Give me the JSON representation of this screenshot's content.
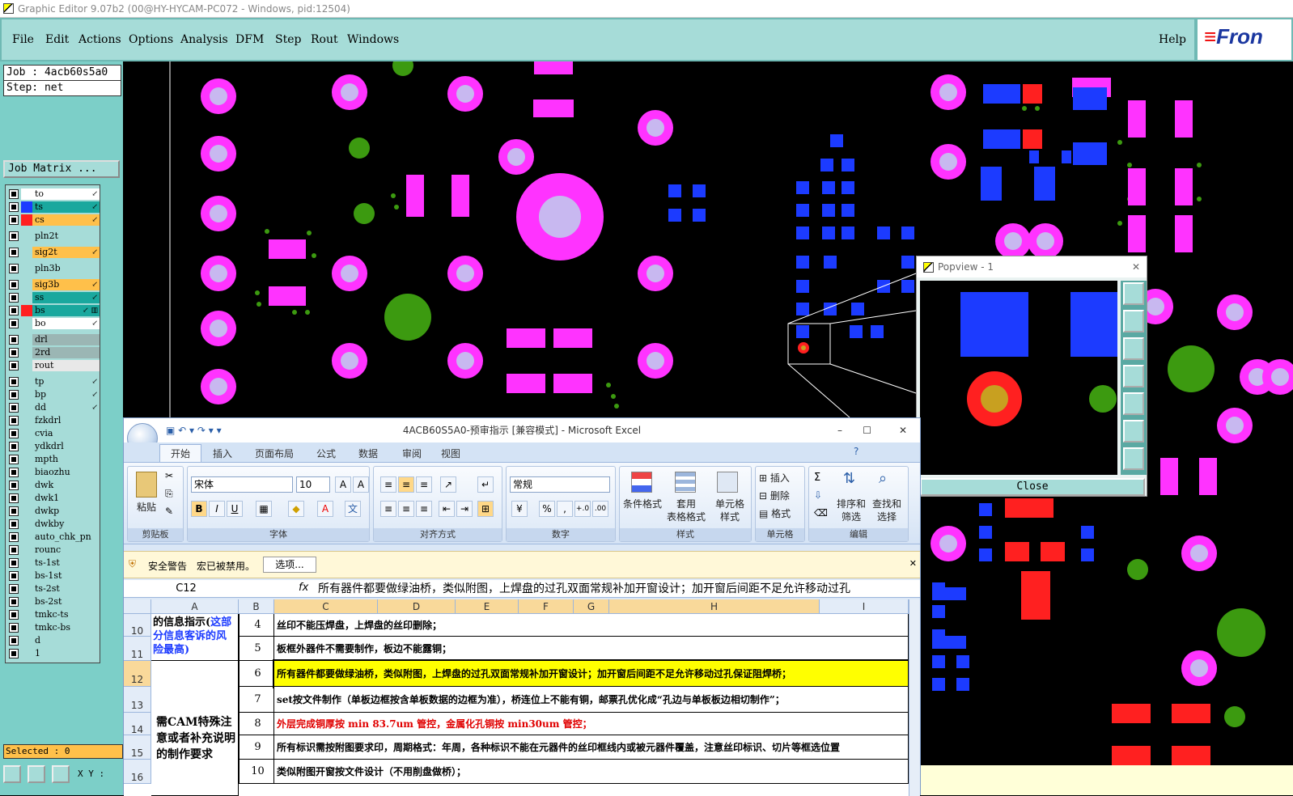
{
  "window": {
    "title": "Graphic Editor 9.07b2 (00@HY-HYCAM-PC072 - Windows, pid:12504)"
  },
  "menu": {
    "items": [
      "File",
      "Edit",
      "Actions",
      "Options",
      "Analysis",
      "DFM",
      "Step",
      "Rout",
      "Windows"
    ],
    "help": "Help",
    "brand": "Fron"
  },
  "job": {
    "job_line": "Job : 4acb60s5a0",
    "step_line": "Step: net",
    "matrix_button": "Job Matrix ..."
  },
  "layers": [
    {
      "name": "to",
      "color": "#ffffff",
      "fill": "#ffffff",
      "flag": "↙"
    },
    {
      "name": "ts",
      "color": "#1c3bff",
      "fill": "#1aa89e",
      "flag": "↙"
    },
    {
      "name": "cs",
      "color": "#ff2020",
      "fill": "#ffc04a",
      "flag": "↙"
    },
    {
      "name": "pln2t",
      "color": "#a6dcd8",
      "fill": "#a6dcd8",
      "flag": ""
    },
    {
      "name": "sig2t",
      "color": "#a6dcd8",
      "fill": "#ffc04a",
      "flag": "↙"
    },
    {
      "name": "pln3b",
      "color": "#a6dcd8",
      "fill": "#a6dcd8",
      "flag": ""
    },
    {
      "name": "sig3b",
      "color": "#a6dcd8",
      "fill": "#ffc04a",
      "flag": "↙"
    },
    {
      "name": "ss",
      "color": "#a6dcd8",
      "fill": "#1aa89e",
      "flag": "↙"
    },
    {
      "name": "bs",
      "color": "#ff2020",
      "fill": "#1aa89e",
      "flag": "↙ ▥"
    },
    {
      "name": "bo",
      "color": "#a6dcd8",
      "fill": "#ffffff",
      "flag": "↙"
    },
    {
      "name": "drl",
      "color": "#a6dcd8",
      "fill": "#9bb6b4",
      "flag": ""
    },
    {
      "name": "2rd",
      "color": "#a6dcd8",
      "fill": "#9bb6b4",
      "flag": ""
    },
    {
      "name": "rout",
      "color": "#a6dcd8",
      "fill": "#e8e8e8",
      "flag": ""
    },
    {
      "name": "tp",
      "color": "#a6dcd8",
      "fill": "#a6dcd8",
      "flag": "↙"
    },
    {
      "name": "bp",
      "color": "#a6dcd8",
      "fill": "#a6dcd8",
      "flag": "↙"
    },
    {
      "name": "dd",
      "color": "#a6dcd8",
      "fill": "#a6dcd8",
      "flag": "↙"
    },
    {
      "name": "fzkdrl",
      "color": "#a6dcd8",
      "fill": "#a6dcd8",
      "flag": ""
    },
    {
      "name": "cvia",
      "color": "#a6dcd8",
      "fill": "#a6dcd8",
      "flag": ""
    },
    {
      "name": "ydkdrl",
      "color": "#a6dcd8",
      "fill": "#a6dcd8",
      "flag": ""
    },
    {
      "name": "mpth",
      "color": "#a6dcd8",
      "fill": "#a6dcd8",
      "flag": ""
    },
    {
      "name": "biaozhu",
      "color": "#a6dcd8",
      "fill": "#a6dcd8",
      "flag": ""
    },
    {
      "name": "dwk",
      "color": "#a6dcd8",
      "fill": "#a6dcd8",
      "flag": ""
    },
    {
      "name": "dwk1",
      "color": "#a6dcd8",
      "fill": "#a6dcd8",
      "flag": ""
    },
    {
      "name": "dwkp",
      "color": "#a6dcd8",
      "fill": "#a6dcd8",
      "flag": ""
    },
    {
      "name": "dwkby",
      "color": "#a6dcd8",
      "fill": "#a6dcd8",
      "flag": ""
    },
    {
      "name": "auto_chk_pn",
      "color": "#a6dcd8",
      "fill": "#a6dcd8",
      "flag": ""
    },
    {
      "name": "rounc",
      "color": "#a6dcd8",
      "fill": "#a6dcd8",
      "flag": ""
    },
    {
      "name": "ts-1st",
      "color": "#a6dcd8",
      "fill": "#a6dcd8",
      "flag": ""
    },
    {
      "name": "bs-1st",
      "color": "#a6dcd8",
      "fill": "#a6dcd8",
      "flag": ""
    },
    {
      "name": "ts-2st",
      "color": "#a6dcd8",
      "fill": "#a6dcd8",
      "flag": ""
    },
    {
      "name": "bs-2st",
      "color": "#a6dcd8",
      "fill": "#a6dcd8",
      "flag": ""
    },
    {
      "name": "tmkc-ts",
      "color": "#a6dcd8",
      "fill": "#a6dcd8",
      "flag": ""
    },
    {
      "name": "tmkc-bs",
      "color": "#a6dcd8",
      "fill": "#a6dcd8",
      "flag": ""
    },
    {
      "name": "d",
      "color": "#a6dcd8",
      "fill": "#a6dcd8",
      "flag": ""
    },
    {
      "name": "1",
      "color": "#a6dcd8",
      "fill": "#a6dcd8",
      "flag": ""
    }
  ],
  "status": {
    "selected": "Selected : 0",
    "xy": "X Y :"
  },
  "colors": {
    "pad": "#ff33ff",
    "hole": "#c8b8f0",
    "smd": "#1c3bff",
    "red": "#ff2020",
    "green": "#3c9a10",
    "panel": "#a6dcd8"
  },
  "popview": {
    "title": "Popview - 1",
    "close": "Close"
  },
  "excel": {
    "title": "4ACB60S5A0-预审指示  [兼容模式] - Microsoft Excel",
    "tabs": [
      "开始",
      "插入",
      "页面布局",
      "公式",
      "数据",
      "审阅",
      "视图"
    ],
    "font_name": "宋体",
    "font_size": "10",
    "number_format": "常规",
    "groups": [
      "剪贴板",
      "字体",
      "对齐方式",
      "数字",
      "样式",
      "单元格",
      "编辑"
    ],
    "paste": "粘贴",
    "style_btns": [
      "条件格式",
      "套用\n表格格式",
      "单元格\n样式"
    ],
    "cell_btns": [
      "插入",
      "删除",
      "格式"
    ],
    "edit_btns": [
      "排序和\n筛选",
      "查找和\n选择"
    ],
    "security_label": "安全警告",
    "security_msg": "宏已被禁用。",
    "security_btn": "选项...",
    "name_box": "C12",
    "formula": "所有器件都要做绿油桥，类似附图，上焊盘的过孔双面常规补加开窗设计；加开窗后间距不足允许移动过孔",
    "columns": [
      "A",
      "B",
      "C",
      "D",
      "E",
      "F",
      "G",
      "H",
      "I"
    ],
    "rows": [
      {
        "num": "10",
        "b": "4",
        "c": "丝印不能压焊盘，上焊盘的丝印删除；",
        "color": "#000000",
        "bg": "#ffffff"
      },
      {
        "num": "11",
        "b": "5",
        "c": "板框外器件不需要制作，板边不能露铜；",
        "color": "#000000",
        "bg": "#ffffff"
      },
      {
        "num": "12",
        "b": "6",
        "c": "所有器件都要做绿油桥，类似附图，上焊盘的过孔双面常规补加开窗设计；加开窗后间距不足允许移动过孔保证阻焊桥；",
        "color": "#000000",
        "bg": "#ffff00"
      },
      {
        "num": "13",
        "b": "7",
        "c": "set按文件制作（单板边框按含单板数据的边框为准），桥连位上不能有铜，邮票孔优化成“孔边与单板板边相切制作”；",
        "color": "#000000",
        "bg": "#ffffff"
      },
      {
        "num": "14",
        "b": "8",
        "c": "外层完成铜厚按 min 83.7um 管控，金属化孔铜按 min30um 管控；",
        "color": "#e00000",
        "bg": "#ffffff"
      },
      {
        "num": "15",
        "b": "9",
        "c": "所有标识需按附图要求印，周期格式：年周，各种标识不能在元器件的丝印框线内或被元器件覆盖，注意丝印标识、切片等框选位置",
        "color": "#000000",
        "bg": "#ffffff"
      },
      {
        "num": "16",
        "b": "10",
        "c": "类似附图开窗按文件设计（不用削盘做桥）；",
        "color": "#000000",
        "bg": "#ffffff"
      }
    ],
    "a_top": "的信息指示(这部分信息客诉的风险最高)",
    "a_top_parts": [
      "的信息指示(",
      "这",
      "部分信息客诉",
      "的风险最高)"
    ],
    "a_bottom": "需CAM特殊注意或者补充说明的制作要求"
  }
}
